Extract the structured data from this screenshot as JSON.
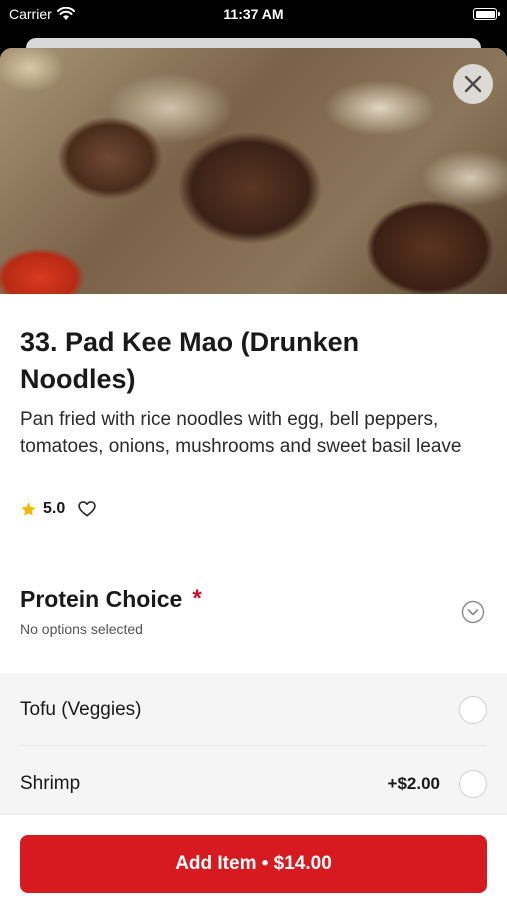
{
  "status_bar": {
    "carrier": "Carrier",
    "time": "11:37 AM",
    "wifi_icon": "wifi-icon",
    "battery_icon": "battery-icon"
  },
  "item": {
    "title": "33. Pad Kee Mao (Drunken Noodles)",
    "description": "Pan fried with rice noodles with egg, bell peppers, tomatoes, onions, mushrooms and sweet basil leave",
    "rating": "5.0",
    "star_icon": "star-icon",
    "favorite_icon": "heart-outline-icon",
    "close_icon": "close-icon"
  },
  "protein": {
    "title": "Protein Choice",
    "required_mark": "*",
    "subtitle": "No options selected",
    "expand_icon": "chevron-down-circle-icon",
    "options": [
      {
        "label": "Tofu (Veggies)",
        "price": ""
      },
      {
        "label": "Shrimp",
        "price": "+$2.00"
      }
    ]
  },
  "footer": {
    "add_button_label": "Add Item • $14.00"
  },
  "colors": {
    "accent_red": "#d71920",
    "required_red": "#c8102e",
    "star_yellow": "#f5b700"
  }
}
